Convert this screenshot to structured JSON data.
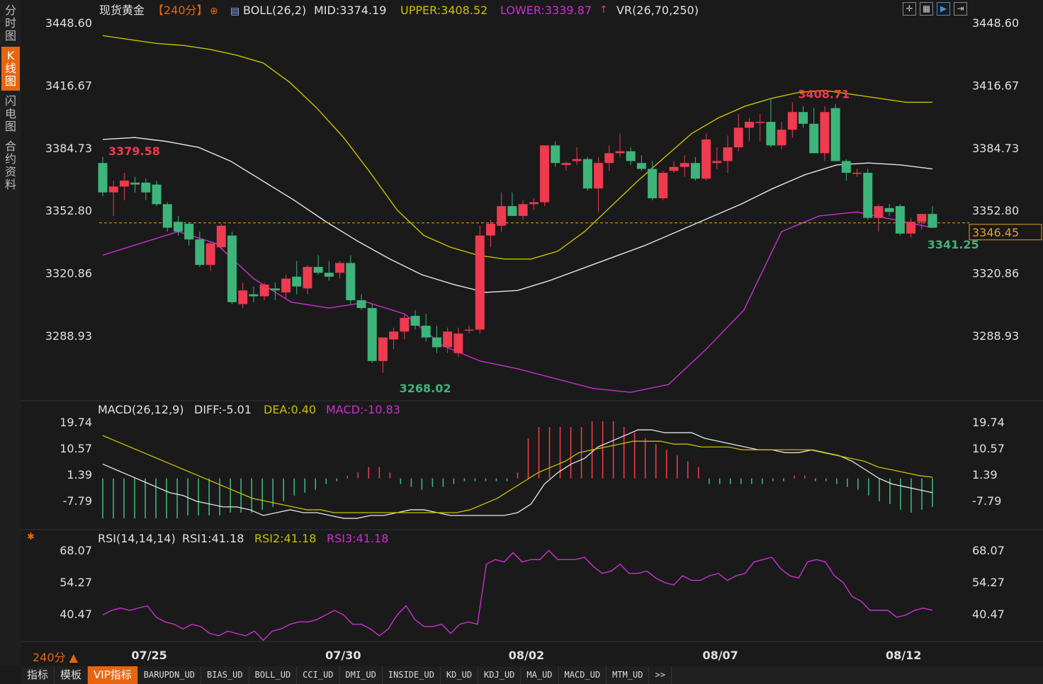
{
  "sidebar": {
    "items": [
      "分时图",
      "K线图",
      "闪电图",
      "合约资料"
    ],
    "active": 1
  },
  "header": {
    "title": "现货黄金",
    "period": "【240分】",
    "boll": {
      "label": "BOLL(26,2)",
      "mid": "MID:3374.19",
      "upper": "UPPER:3408.52",
      "lower": "LOWER:3339.87"
    },
    "vr": "VR(26,70,250)"
  },
  "macd_header": {
    "label": "MACD(26,12,9)",
    "diff": "DIFF:-5.01",
    "dea": "DEA:0.40",
    "macd": "MACD:-10.83"
  },
  "rsi_header": {
    "label": "RSI(14,14,14)",
    "rsi1": "RSI1:41.18",
    "rsi2": "RSI2:41.18",
    "rsi3": "RSI3:41.18"
  },
  "period_selector": "240分 ▲",
  "toolbar_icons": [
    "crosshair-icon",
    "grid-icon",
    "play-icon",
    "step-icon"
  ],
  "tabs": [
    "指标",
    "模板",
    "VIP指标",
    "BARUPDN_UD",
    "BIAS_UD",
    "BOLL_UD",
    "CCI_UD",
    "DMI_UD",
    "INSIDE_UD",
    "KD_UD",
    "KDJ_UD",
    "MA_UD",
    "MACD_UD",
    "MTM_UD",
    ">>"
  ],
  "active_tab": 2,
  "colors": {
    "up": "#ef3a4f",
    "down": "#3db47a",
    "mid": "#e6e6e6",
    "upper": "#c8c100",
    "lower": "#cc2fd0",
    "rsi": "#cc2fd0",
    "last": "#e8a020",
    "accent": "#e8650f"
  },
  "chart_data": {
    "type": "candlestick",
    "x_labels": [
      "07/25",
      "07/30",
      "08/02",
      "08/07",
      "08/12"
    ],
    "price_axis": {
      "ticks": [
        3448.6,
        3416.67,
        3384.73,
        3352.8,
        3320.86,
        3288.93
      ],
      "ylim": [
        3240,
        3455
      ]
    },
    "last_price": "3346.45",
    "last_price_value": 3346.45,
    "annotations": [
      {
        "text": "3379.58",
        "value": 3379.58,
        "index": 0
      },
      {
        "text": "3268.02",
        "value": 3268.02,
        "index": 27
      },
      {
        "text": "3408.71",
        "value": 3408.71,
        "index": 64
      },
      {
        "text": "3341.25",
        "value": 3341.25,
        "index": 76
      }
    ],
    "candles": [
      [
        3377,
        3380,
        3360,
        3362
      ],
      [
        3362,
        3368,
        3350,
        3365
      ],
      [
        3365,
        3372,
        3358,
        3368
      ],
      [
        3367,
        3370,
        3362,
        3366
      ],
      [
        3367,
        3369,
        3358,
        3362
      ],
      [
        3366,
        3368,
        3355,
        3356
      ],
      [
        3356,
        3357,
        3342,
        3344
      ],
      [
        3347,
        3350,
        3340,
        3342
      ],
      [
        3346,
        3347,
        3335,
        3338
      ],
      [
        3338,
        3342,
        3324,
        3325
      ],
      [
        3325,
        3337,
        3322,
        3336
      ],
      [
        3334,
        3346,
        3333,
        3345
      ],
      [
        3340,
        3342,
        3305,
        3306
      ],
      [
        3305,
        3316,
        3303,
        3312
      ],
      [
        3310,
        3314,
        3306,
        3309
      ],
      [
        3309,
        3316,
        3307,
        3315
      ],
      [
        3313,
        3316,
        3307,
        3312
      ],
      [
        3311,
        3320,
        3308,
        3318
      ],
      [
        3319,
        3327,
        3310,
        3314
      ],
      [
        3313,
        3325,
        3310,
        3324
      ],
      [
        3324,
        3330,
        3320,
        3321
      ],
      [
        3321,
        3327,
        3317,
        3319
      ],
      [
        3321,
        3327,
        3318,
        3326
      ],
      [
        3326,
        3330,
        3305,
        3307
      ],
      [
        3307,
        3310,
        3302,
        3303
      ],
      [
        3303,
        3305,
        3275,
        3276
      ],
      [
        3276,
        3288,
        3270,
        3288
      ],
      [
        3287,
        3293,
        3282,
        3291
      ],
      [
        3291,
        3300,
        3287,
        3298
      ],
      [
        3299,
        3302,
        3292,
        3294
      ],
      [
        3294,
        3300,
        3286,
        3288
      ],
      [
        3288,
        3294,
        3280,
        3283
      ],
      [
        3283,
        3293,
        3280,
        3291
      ],
      [
        3280,
        3293,
        3278,
        3290
      ],
      [
        3292,
        3294,
        3290,
        3292
      ],
      [
        3292,
        3345,
        3290,
        3340
      ],
      [
        3340,
        3348,
        3334,
        3346
      ],
      [
        3345,
        3362,
        3342,
        3355
      ],
      [
        3355,
        3362,
        3350,
        3350
      ],
      [
        3350,
        3358,
        3348,
        3356
      ],
      [
        3356,
        3359,
        3353,
        3357
      ],
      [
        3357,
        3386,
        3355,
        3386
      ],
      [
        3386,
        3388,
        3375,
        3377
      ],
      [
        3376,
        3378,
        3373,
        3377
      ],
      [
        3378,
        3385,
        3376,
        3379
      ],
      [
        3379,
        3380,
        3363,
        3364
      ],
      [
        3364,
        3380,
        3352,
        3377
      ],
      [
        3377,
        3386,
        3373,
        3382
      ],
      [
        3382,
        3392,
        3380,
        3383
      ],
      [
        3383,
        3385,
        3376,
        3378
      ],
      [
        3377,
        3381,
        3373,
        3374
      ],
      [
        3374,
        3378,
        3358,
        3359
      ],
      [
        3359,
        3373,
        3358,
        3372
      ],
      [
        3373,
        3378,
        3372,
        3375
      ],
      [
        3375,
        3381,
        3370,
        3377
      ],
      [
        3377,
        3380,
        3368,
        3369
      ],
      [
        3369,
        3392,
        3368,
        3389
      ],
      [
        3377,
        3385,
        3374,
        3378
      ],
      [
        3378,
        3391,
        3372,
        3385
      ],
      [
        3385,
        3402,
        3383,
        3395
      ],
      [
        3395,
        3400,
        3388,
        3398
      ],
      [
        3398,
        3402,
        3388,
        3398
      ],
      [
        3398,
        3410,
        3385,
        3386
      ],
      [
        3386,
        3398,
        3384,
        3394
      ],
      [
        3394,
        3408,
        3390,
        3403
      ],
      [
        3403,
        3406,
        3395,
        3397
      ],
      [
        3397,
        3405,
        3382,
        3382
      ],
      [
        3382,
        3406,
        3378,
        3403
      ],
      [
        3405,
        3407,
        3378,
        3378
      ],
      [
        3378,
        3379,
        3368,
        3372
      ],
      [
        3372,
        3374,
        3370,
        3372
      ],
      [
        3372,
        3374,
        3348,
        3349
      ],
      [
        3349,
        3356,
        3342,
        3355
      ],
      [
        3354,
        3356,
        3350,
        3352
      ],
      [
        3355,
        3356,
        3340,
        3341
      ],
      [
        3341,
        3349,
        3339,
        3347
      ],
      [
        3347,
        3351,
        3343,
        3351
      ],
      [
        3351,
        3355,
        3344,
        3344
      ]
    ],
    "boll_upper": [
      3442,
      3440,
      3438,
      3437,
      3435,
      3432,
      3428,
      3418,
      3405,
      3390,
      3372,
      3353,
      3340,
      3334,
      3330,
      3328,
      3328,
      3332,
      3342,
      3355,
      3368,
      3380,
      3392,
      3400,
      3406,
      3410,
      3413,
      3414,
      3412,
      3410,
      3408,
      3408
    ],
    "boll_mid": [
      3389,
      3390,
      3388,
      3385,
      3378,
      3368,
      3358,
      3347,
      3337,
      3328,
      3320,
      3315,
      3311,
      3312,
      3317,
      3323,
      3329,
      3335,
      3342,
      3349,
      3356,
      3364,
      3371,
      3376,
      3377,
      3376,
      3374
    ],
    "boll_lower": [
      3330,
      3336,
      3342,
      3336,
      3318,
      3306,
      3303,
      3306,
      3300,
      3284,
      3276,
      3272,
      3267,
      3262,
      3260,
      3264,
      3282,
      3302,
      3342,
      3350,
      3352,
      3348,
      3344
    ],
    "macd": {
      "ticks": [
        19.74,
        10.57,
        1.39,
        -7.79
      ],
      "ylim": [
        -16,
        24
      ],
      "hist": [
        -14,
        -14,
        -14,
        -14,
        -14,
        -14,
        -14,
        -14,
        -13,
        -13,
        -13,
        -13,
        -12,
        -12,
        -12,
        -11,
        -10,
        -8,
        -6,
        -5,
        -4,
        -2,
        -1,
        1,
        2,
        4,
        4,
        2,
        -2,
        -3,
        -4,
        -3,
        -3,
        -2,
        -1,
        -1,
        -1,
        -1,
        -1,
        2,
        14,
        18,
        18,
        18,
        18,
        18,
        20,
        20,
        20,
        18,
        16,
        14,
        12,
        10,
        8,
        6,
        4,
        -2,
        -2,
        -2,
        -2,
        -2,
        -2,
        -1,
        -1,
        1,
        1,
        -1,
        -1,
        -2,
        -3,
        -4,
        -6,
        -8,
        -9,
        -11,
        -12,
        -11,
        -10
      ],
      "diff": [
        5,
        3,
        1,
        -1,
        -3,
        -5,
        -6,
        -8,
        -9,
        -10,
        -10,
        -11,
        -13,
        -12,
        -11,
        -12,
        -12,
        -13,
        -14,
        -14,
        -13,
        -13,
        -12,
        -11,
        -11,
        -12,
        -13,
        -13,
        -13,
        -13,
        -13,
        -12,
        -9,
        -2,
        2,
        5,
        7,
        11,
        13,
        15,
        17,
        17,
        16,
        16,
        16,
        14,
        13,
        12,
        11,
        10,
        10,
        9,
        9,
        10,
        9,
        8,
        6,
        3,
        0,
        -2,
        -3,
        -4,
        -5
      ],
      "dea": [
        15,
        13,
        11,
        9,
        7,
        5,
        3,
        1,
        -1,
        -3,
        -5,
        -7,
        -8,
        -9,
        -10,
        -11,
        -11,
        -12,
        -12,
        -12,
        -12,
        -12,
        -12,
        -12,
        -12,
        -12,
        -12,
        -11,
        -9,
        -7,
        -4,
        -1,
        2,
        4,
        6,
        9,
        10,
        11,
        12,
        13,
        13,
        13,
        12,
        12,
        11,
        11,
        11,
        10,
        10,
        10,
        10,
        10,
        10,
        9,
        8,
        7,
        6,
        4,
        3,
        2,
        1,
        0.4
      ]
    },
    "rsi": {
      "ticks": [
        68.07,
        54.27,
        40.47
      ],
      "ylim": [
        26,
        72
      ],
      "values": [
        40,
        42,
        43,
        42,
        43,
        44,
        39,
        37,
        36,
        34,
        36,
        35,
        32,
        31,
        33,
        32,
        31,
        33,
        29,
        33,
        34,
        36,
        37,
        37,
        38,
        40,
        42,
        40,
        36,
        36,
        34,
        31,
        34,
        40,
        44,
        38,
        35,
        35,
        36,
        32,
        36,
        37,
        36,
        62,
        64,
        63,
        67,
        63,
        64,
        64,
        68,
        64,
        64,
        64,
        65,
        61,
        58,
        59,
        62,
        58,
        58,
        59,
        56,
        54,
        53,
        57,
        55,
        55,
        57,
        58,
        55,
        57,
        58,
        63,
        64,
        65,
        60,
        57,
        56,
        63,
        64,
        63,
        57,
        54,
        48,
        46,
        42,
        42,
        42,
        39,
        40,
        42,
        43,
        42
      ]
    }
  }
}
